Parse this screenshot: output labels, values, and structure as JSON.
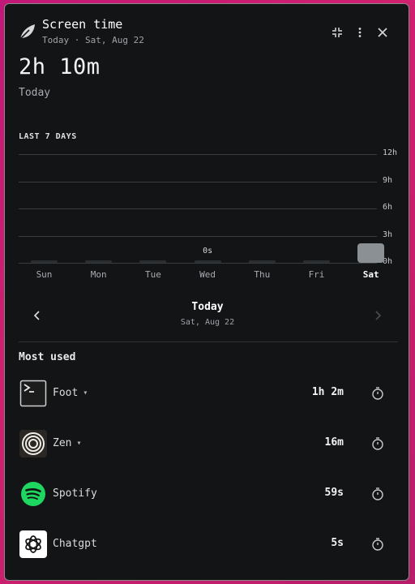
{
  "header": {
    "title": "Screen time",
    "subtitle": "Today · Sat, Aug 22",
    "icons": [
      "leaf-icon",
      "collapse-icon",
      "more-vertical-icon",
      "close-icon"
    ]
  },
  "summary": {
    "total": "2h 10m",
    "label": "Today"
  },
  "chart_section_label": "LAST 7 DAYS",
  "chart_data": {
    "type": "bar",
    "categories": [
      "Sun",
      "Mon",
      "Tue",
      "Wed",
      "Thu",
      "Fri",
      "Sat"
    ],
    "values": [
      0,
      0,
      0,
      0,
      0,
      0,
      2.17
    ],
    "value_labels": [
      "",
      "",
      "",
      "0s",
      "",
      "",
      ""
    ],
    "yticks": [
      "12h",
      "9h",
      "6h",
      "3h",
      "0h"
    ],
    "ylim": [
      0,
      12
    ],
    "selected": "Sat",
    "colors": {
      "bar": "#2b2e31",
      "selected_bar": "#8b9095",
      "grid": "#3a3d40"
    }
  },
  "day_nav": {
    "title": "Today",
    "date": "Sat, Aug 22",
    "prev_icon": "chevron-left-icon",
    "next_icon": "chevron-right-icon"
  },
  "most_used": {
    "label": "Most used",
    "apps": [
      {
        "name": "Foot",
        "time": "1h 2m",
        "has_dropdown": true,
        "icon": "terminal-icon"
      },
      {
        "name": "Zen",
        "time": "16m",
        "has_dropdown": true,
        "icon": "zen-browser-icon"
      },
      {
        "name": "Spotify",
        "time": "59s",
        "has_dropdown": false,
        "icon": "spotify-icon"
      },
      {
        "name": "Chatgpt",
        "time": "5s",
        "has_dropdown": false,
        "icon": "chatgpt-icon"
      }
    ],
    "timer_icon": "timer-icon"
  },
  "colors": {
    "background": "#121416",
    "desktop": "#c21878",
    "spotify": "#1ed760"
  }
}
